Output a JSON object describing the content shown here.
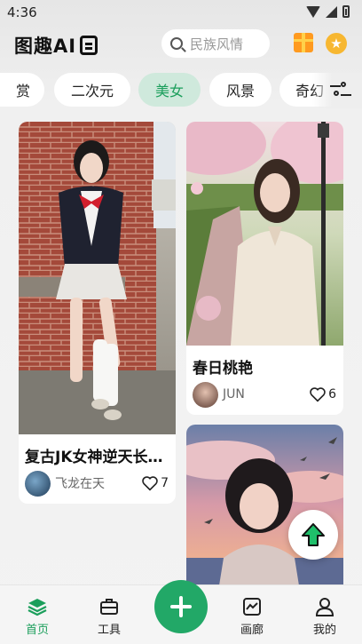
{
  "status": {
    "time": "4:36"
  },
  "header": {
    "logo": "图趣AI",
    "search_placeholder": "民族风情"
  },
  "tabs": [
    {
      "label": "赏"
    },
    {
      "label": "二次元"
    },
    {
      "label": "美女",
      "active": true
    },
    {
      "label": "风景"
    },
    {
      "label": "奇幻"
    }
  ],
  "cards": [
    {
      "title": "复古JK女神逆天长…",
      "author": "飞龙在天",
      "likes": "7"
    },
    {
      "title": "春日桃艳",
      "author": "JUN",
      "likes": "6"
    }
  ],
  "nav": {
    "home": "首页",
    "tools": "工具",
    "gallery": "画廊",
    "mine": "我的"
  },
  "colors": {
    "accent": "#1b9e5b",
    "accent_bg": "#cfe9dc",
    "add_button": "#22a867"
  }
}
